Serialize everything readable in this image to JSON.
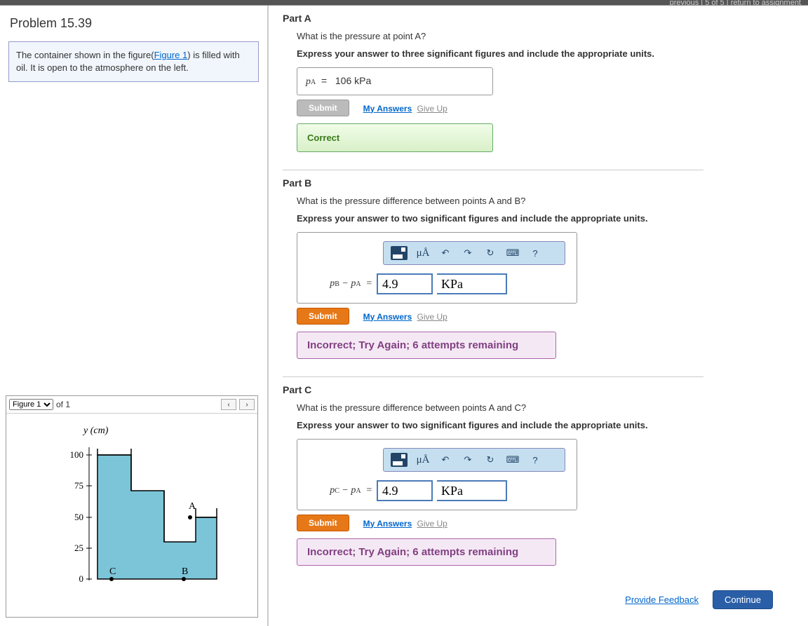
{
  "nav": {
    "prev": "previous",
    "pos": "5 of 5",
    "ret": "return to assignment"
  },
  "problem": {
    "title": "Problem 15.39",
    "desc_pre": "The container shown in the figure(",
    "desc_link": "Figure 1",
    "desc_post": ") is filled with oil. It is open to the atmosphere on the left."
  },
  "figure": {
    "selected": "Figure 1",
    "of_text": "of 1",
    "prev": "‹",
    "next": "›",
    "y_label": "y (cm)",
    "ticks": [
      "100",
      "75",
      "50",
      "25",
      "0"
    ],
    "points": {
      "A": "A",
      "B": "B",
      "C": "C"
    }
  },
  "actions": {
    "submit": "Submit",
    "my_answers": "My Answers",
    "give_up": "Give Up"
  },
  "partA": {
    "title": "Part A",
    "question": "What is the pressure at point A?",
    "instruction": "Express your answer to three significant figures and include the appropriate units.",
    "lhs_var": "p",
    "lhs_sub": "A",
    "eq": "=",
    "value": "106 kPa",
    "feedback": "Correct"
  },
  "partB": {
    "title": "Part B",
    "question": "What is the pressure difference between points A and B?",
    "instruction": "Express your answer to two significant figures and include the appropriate units.",
    "lhs": "p",
    "sub1": "B",
    "minus": "−",
    "sub2": "A",
    "eq": "=",
    "value": "4.9",
    "unit": "KPa",
    "toolbar_ua": "μÅ",
    "toolbar_q": "?",
    "feedback": "Incorrect; Try Again; 6 attempts remaining"
  },
  "partC": {
    "title": "Part C",
    "question": "What is the pressure difference between points A and C?",
    "instruction": "Express your answer to two significant figures and include the appropriate units.",
    "lhs": "p",
    "sub1": "C",
    "minus": "−",
    "sub2": "A",
    "eq": "=",
    "value": "4.9",
    "unit": "KPa",
    "toolbar_ua": "μÅ",
    "toolbar_q": "?",
    "feedback": "Incorrect; Try Again; 6 attempts remaining"
  },
  "footer": {
    "provide": "Provide Feedback",
    "continue": "Continue"
  }
}
